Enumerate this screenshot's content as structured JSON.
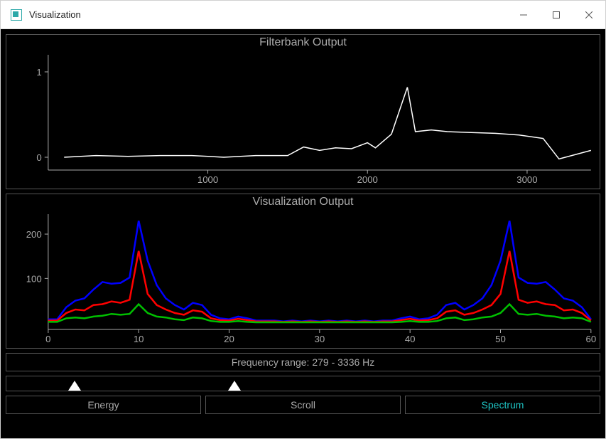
{
  "window": {
    "title": "Visualization"
  },
  "filterbank": {
    "title": "Filterbank Output",
    "xlabel": "",
    "ylabel": "",
    "xlim": [
      0,
      3400
    ],
    "ylim": [
      -0.15,
      1.2
    ],
    "xticks": [
      1000,
      2000,
      3000
    ],
    "yticks": [
      0,
      1
    ],
    "chart_data": {
      "type": "line",
      "x": [
        100,
        300,
        500,
        700,
        900,
        1000,
        1100,
        1300,
        1500,
        1600,
        1700,
        1800,
        1900,
        2000,
        2050,
        2150,
        2250,
        2300,
        2400,
        2500,
        2650,
        2800,
        2950,
        3100,
        3200,
        3300,
        3400
      ],
      "values": [
        0.0,
        0.02,
        0.01,
        0.02,
        0.02,
        0.01,
        0.0,
        0.02,
        0.02,
        0.12,
        0.08,
        0.11,
        0.1,
        0.17,
        0.11,
        0.27,
        0.82,
        0.3,
        0.32,
        0.3,
        0.29,
        0.28,
        0.26,
        0.22,
        -0.02,
        0.03,
        0.08
      ]
    }
  },
  "visualization": {
    "title": "Visualization Output",
    "xlabel": "",
    "ylabel": "",
    "xlim": [
      0,
      60
    ],
    "ylim": [
      -15,
      245
    ],
    "xticks": [
      0,
      10,
      20,
      30,
      40,
      50,
      60
    ],
    "yticks": [
      100,
      200
    ],
    "chart_data": {
      "type": "line",
      "x": [
        0,
        1,
        2,
        3,
        4,
        5,
        6,
        7,
        8,
        9,
        10,
        11,
        12,
        13,
        14,
        15,
        16,
        17,
        18,
        19,
        20,
        21,
        22,
        23,
        24,
        25,
        26,
        27,
        28,
        29,
        30,
        31,
        32,
        33,
        34,
        35,
        36,
        37,
        38,
        39,
        40,
        41,
        42,
        43,
        44,
        45,
        46,
        47,
        48,
        49,
        50,
        51,
        52,
        53,
        54,
        55,
        56,
        57,
        58,
        59,
        60
      ],
      "series": [
        {
          "name": "blue",
          "values": [
            8,
            8,
            35,
            50,
            55,
            75,
            92,
            88,
            90,
            102,
            230,
            140,
            85,
            55,
            40,
            30,
            45,
            40,
            18,
            10,
            8,
            14,
            10,
            5,
            5,
            5,
            3,
            5,
            3,
            5,
            3,
            5,
            3,
            5,
            3,
            5,
            3,
            5,
            5,
            10,
            14,
            8,
            10,
            18,
            40,
            45,
            30,
            40,
            55,
            85,
            140,
            230,
            102,
            90,
            88,
            92,
            75,
            55,
            50,
            35,
            8
          ]
        },
        {
          "name": "red",
          "values": [
            5,
            5,
            22,
            30,
            28,
            40,
            42,
            48,
            45,
            52,
            162,
            65,
            40,
            30,
            22,
            18,
            28,
            25,
            10,
            6,
            5,
            9,
            6,
            3,
            3,
            3,
            2,
            3,
            2,
            3,
            2,
            3,
            2,
            3,
            2,
            3,
            2,
            3,
            3,
            6,
            9,
            5,
            6,
            10,
            25,
            28,
            18,
            22,
            30,
            40,
            65,
            162,
            52,
            45,
            48,
            42,
            40,
            28,
            30,
            22,
            5
          ]
        },
        {
          "name": "green",
          "values": [
            2,
            2,
            10,
            12,
            10,
            14,
            16,
            20,
            18,
            20,
            42,
            22,
            14,
            12,
            8,
            6,
            12,
            10,
            4,
            2,
            2,
            4,
            2,
            1,
            1,
            1,
            1,
            1,
            1,
            1,
            1,
            1,
            1,
            1,
            1,
            1,
            1,
            1,
            1,
            2,
            4,
            2,
            2,
            4,
            10,
            12,
            6,
            8,
            12,
            14,
            22,
            42,
            20,
            18,
            20,
            16,
            14,
            10,
            12,
            10,
            2
          ]
        }
      ]
    }
  },
  "frequency_range": {
    "label": "Frequency range: 279 - 3336 Hz",
    "low_pct": 11.5,
    "high_pct": 38.5
  },
  "modes": {
    "options": [
      "Energy",
      "Scroll",
      "Spectrum"
    ],
    "active": "Spectrum"
  }
}
